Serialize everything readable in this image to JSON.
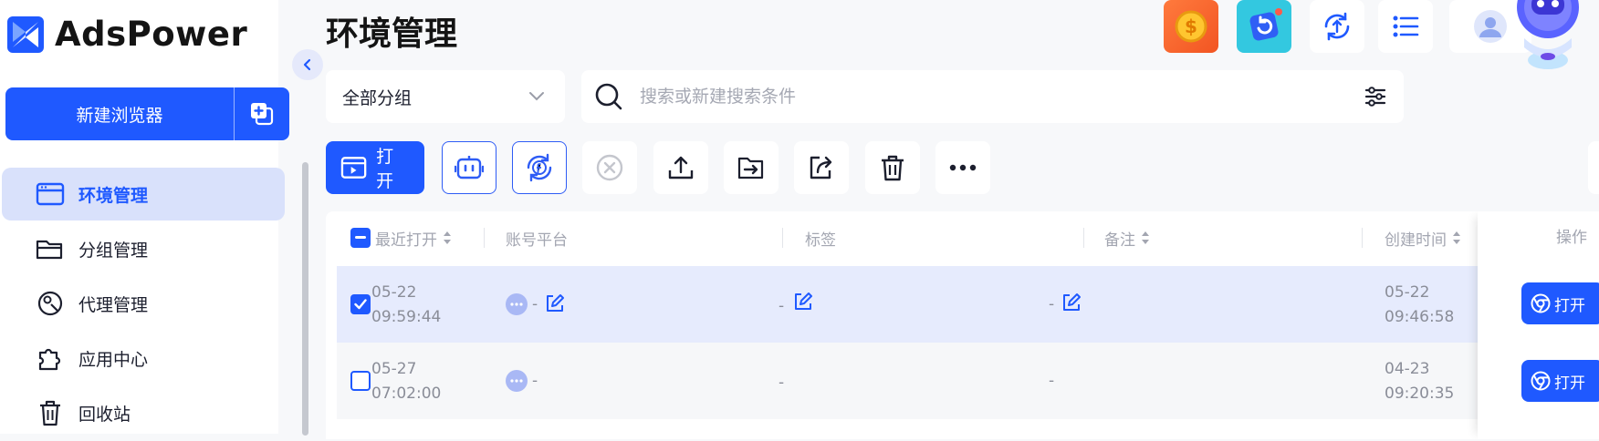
{
  "app": {
    "name": "AdsPower"
  },
  "sidebar": {
    "new_browser_label": "新建浏览器",
    "items": [
      {
        "label": "环境管理",
        "icon": "browser-window-icon",
        "active": true
      },
      {
        "label": "分组管理",
        "icon": "folder-icon",
        "active": false
      },
      {
        "label": "代理管理",
        "icon": "proxy-pin-icon",
        "active": false
      },
      {
        "label": "应用中心",
        "icon": "puzzle-icon",
        "active": false
      },
      {
        "label": "回收站",
        "icon": "trash-icon",
        "active": false
      }
    ]
  },
  "header": {
    "title": "环境管理",
    "top_icons": [
      "coin-icon",
      "refresh-badge-icon",
      "sync-upload-icon",
      "list-icon",
      "avatar-icon"
    ]
  },
  "filters": {
    "group_select_value": "全部分组",
    "search_placeholder": "搜索或新建搜索条件"
  },
  "toolbar": {
    "open_label": "打开",
    "buttons": [
      "robot-icon",
      "facebook-sync-icon",
      "close-circle-icon",
      "upload-icon",
      "move-to-icon",
      "share-icon",
      "delete-icon",
      "more-icon"
    ]
  },
  "table": {
    "headers": {
      "last_opened": "最近打开",
      "platform": "账号平台",
      "tags": "标签",
      "notes": "备注",
      "created": "创建时间",
      "actions": "操作"
    },
    "rows": [
      {
        "selected": true,
        "last_opened_date": "05-22",
        "last_opened_time": "09:59:44",
        "platform": "-",
        "tags": "-",
        "notes": "-",
        "created_date": "05-22",
        "created_time": "09:46:58",
        "action_label": "打开"
      },
      {
        "selected": false,
        "last_opened_date": "05-27",
        "last_opened_time": "07:02:00",
        "platform": "-",
        "tags": "-",
        "notes": "-",
        "created_date": "04-23",
        "created_time": "09:20:35",
        "action_label": "打开"
      }
    ]
  },
  "colors": {
    "primary": "#1f59ff",
    "active_nav_bg": "#d9e1fb",
    "selected_row_bg": "#e6ebfd",
    "muted_text": "#8a8d98"
  }
}
